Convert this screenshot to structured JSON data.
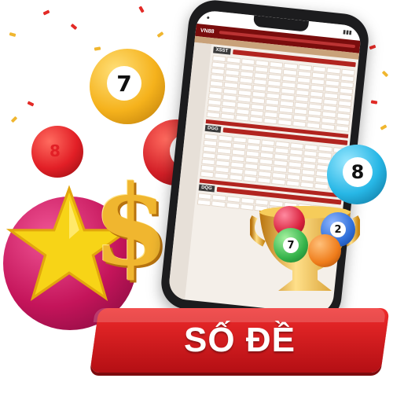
{
  "banner": {
    "title": "SỐ ĐỀ"
  },
  "phone": {
    "brand_logo": "VN88",
    "game_badges": [
      "XSST",
      "DGG",
      "DQG"
    ]
  },
  "balls": [
    {
      "number": "7",
      "color": "#f5b21c"
    },
    {
      "number": "8",
      "color": "#e21f26"
    },
    {
      "number": "9",
      "color": "#d31f27"
    },
    {
      "number": "8",
      "color": "#27b7e6"
    }
  ],
  "trophy_balls": [
    {
      "number": "2",
      "color": "#2f6fd9"
    },
    {
      "number": "7",
      "color": "#35b34a"
    }
  ],
  "colors": {
    "accent_red": "#e02326",
    "gold": "#f0b62f",
    "star": "#f7d417",
    "pink_ball": "#c4145a"
  }
}
